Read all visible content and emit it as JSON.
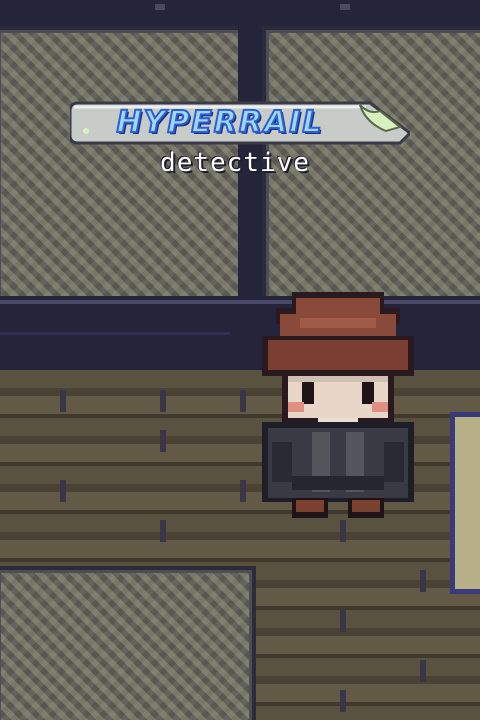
{
  "game": {
    "title_logo": "HYPERRAIL",
    "subtitle": "detective"
  },
  "colors": {
    "logo_text": "#9fd8ff",
    "logo_outline": "#2e5fd0",
    "banner_fill": "#c8ccc8",
    "banner_leaf": "#d8efc0",
    "floor": "#5a5240",
    "glass_case": "#6a6a60",
    "hat": "#8a4a3a",
    "coat": "#3a3a44"
  },
  "scene": {
    "character": "detective-sprite",
    "environment": "train-car-interior"
  }
}
